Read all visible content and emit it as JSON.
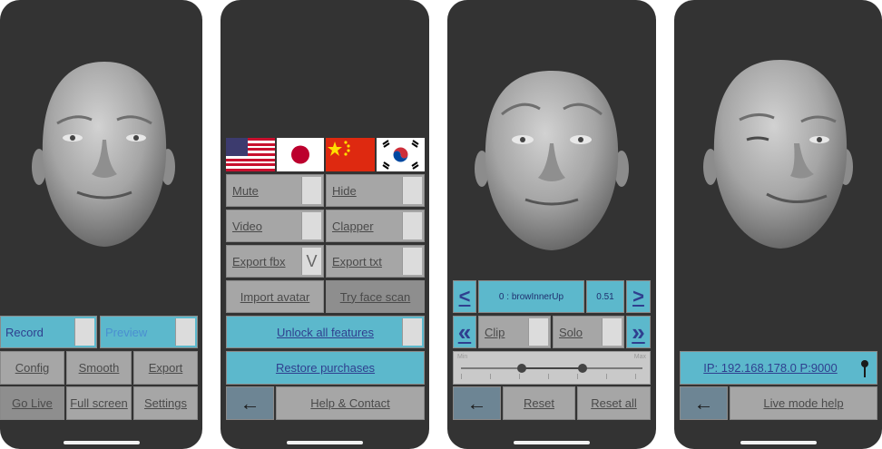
{
  "screen1": {
    "record_label": "Record",
    "preview_label": "Preview",
    "config_label": "Config",
    "smooth_label": "Smooth",
    "export_label": "Export",
    "golive_label": "Go Live",
    "fullscreen_label": "Full screen",
    "settings_label": "Settings"
  },
  "screen2": {
    "mute_label": "Mute",
    "hide_label": "Hide",
    "video_label": "Video",
    "clapper_label": "Clapper",
    "export_fbx_label": "Export fbx",
    "export_fbx_chevron": "V",
    "export_txt_label": "Export txt",
    "import_avatar_label": "Import avatar",
    "try_face_scan_label": "Try face scan",
    "unlock_label": "Unlock all features",
    "restore_label": "Restore purchases",
    "back_glyph": "←",
    "help_label": "Help & Contact",
    "flags": [
      "us-flag-icon",
      "japan-flag-icon",
      "china-flag-icon",
      "korea-flag-icon"
    ]
  },
  "screen3": {
    "prev_glyph": "<",
    "blendshape_name": "0 : browInnerUp",
    "blendshape_value": "0.51",
    "next_glyph": ">",
    "rewind_glyph": "«",
    "clip_label": "Clip",
    "solo_label": "Solo",
    "forward_glyph": "»",
    "slider_min_label": "Min",
    "slider_max_label": "Max",
    "back_glyph": "←",
    "reset_label": "Reset",
    "reset_all_label": "Reset all"
  },
  "screen4": {
    "ip_label": "IP: 192.168.178.0 P:9000",
    "back_glyph": "←",
    "help_label": "Live mode help"
  },
  "colors": {
    "phone_bg": "#333333",
    "button_gray": "#a6a6a6",
    "button_cyan": "#5cb8cc",
    "button_slate": "#6d8594",
    "link_blue": "#2f3f8f"
  }
}
